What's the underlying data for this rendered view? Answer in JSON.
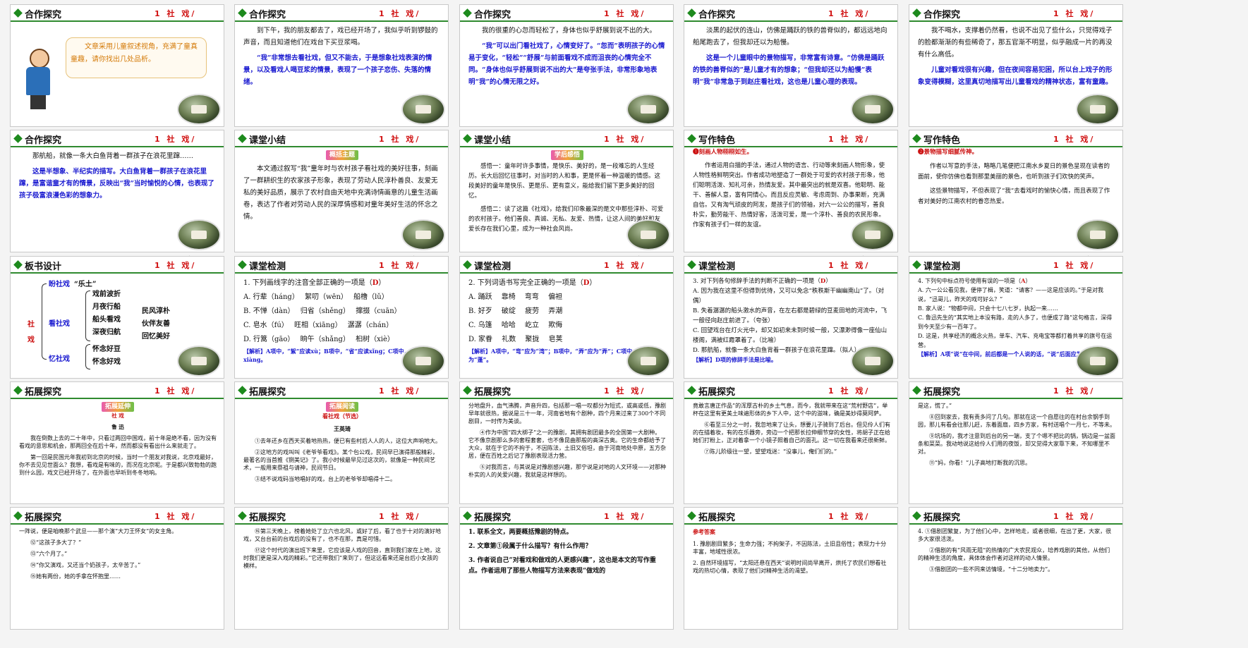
{
  "slides": [
    {
      "num": "41",
      "section": "合作探究",
      "title": "1 社 戏/",
      "bubble": "文章采用儿童叙述视角，充满了童真童趣，请你找出几处品析。"
    },
    {
      "num": "42",
      "section": "合作探究",
      "title": "1 社 戏/",
      "p1": "到下午，我的朋友都去了，戏已经开场了，我似乎听到锣鼓的声音，而且知道他们在戏台下买豆浆喝。",
      "p2": "“我”非常想去看社戏，但又不能去，于是想象社戏表演的情景，以及看戏人喝豆浆的情景，表现了一个孩子恋伤、失落的情绪。"
    },
    {
      "num": "43",
      "section": "合作探究",
      "title": "1 社 戏/",
      "p1": "我的很重的心忽而轻松了，身体也似乎舒展到说不出的大。",
      "p2": "“我”可以出门看社戏了，心情变好了。“忽而”表明孩子的心情易于变化，“轻松”“舒展”与前面看戏不成而沮丧的心情完全不同。“身体也似乎舒展到说不出的大”是夸张手法，非常形象地表明“我”的心情无限之好。"
    },
    {
      "num": "44",
      "section": "合作探究",
      "title": "1 社 戏/",
      "p1": "淡黑的起伏的连山，仿佛是踊跃的铁的兽脊似的，都远远地向船尾跑去了，但我却还以为船慢。",
      "p2": "这是一个儿童眼中的景物描写，非常富有诗意。“仿佛是踊跃的铁的兽脊似的”是儿童才有的想象；“但我却还以为船慢”表明“我”非常急于到赵庄看社戏，这也是儿童心理的表现。"
    },
    {
      "num": "45",
      "section": "合作探究",
      "title": "1 社 戏/",
      "p1": "我不喝水，支撑着仍然看，也说不出见了些什么，只觉得戏子的脸都渐渐的有些稀奇了，那五官渐不明显，似乎融成一片的再没有什么高低。",
      "p2": "儿童对看戏很有兴趣，但在夜间容易犯困，所以台上戏子的形象变得模糊，这里真切地描写出儿童看戏的精神状态，富有童趣。"
    },
    {
      "num": "46",
      "section": "合作探究",
      "title": "1 社 戏/",
      "p1": "那航船，就像一条大白鱼背着一群孩子在浪花里蹿……",
      "p2": "这是半想象、半纪实的描写。大白鱼背着一群孩子在浪花里蹿，是富谐童才有的情景，反映出“我”当时愉悦的心情，也表现了孩子极富浪漫色彩的想象力。"
    },
    {
      "num": "47",
      "section": "课堂小结",
      "title": "1 社 戏/",
      "badge": "概括主题",
      "p1": "本文通过叙写“我”童年时与农村孩子看社戏的美好往事，刻画了一群耕织生的农家孩子形象，表现了劳动人民淳朴善良、友爱无私的美好品质，展示了农村自由天地中充满诗情画意的儿童生活画卷，表达了作者对劳动人民的深厚情感和对童年美好生活的怀念之情。"
    },
    {
      "num": "48",
      "section": "课堂小结",
      "title": "1 社 戏/",
      "badge": "学后感悟",
      "p1": "感悟一：童年时许多事情，是快乐、美好的，是一段难忘的人生经历。长大后回忆往事时，对当时的人和事，更是怀着一种温暖的情感。这段美好的童年是快乐、更是乐、更有意义，能给我们留下更多美好的回忆。",
      "p2": "感悟二：读了这篇《社戏》，给我们印象最深的是文中那些淳朴、可爱的农村孩子。他们善良、真诚、无私、友爱、热情，让这人间的美好和友爱长存在我们心里，成为一种社会风尚。"
    },
    {
      "num": "49",
      "section": "写作特色",
      "title": "1 社 戏/",
      "h": "❶刻画人物栩栩如生。",
      "p1": "作者运用白描的手法，通过人物的语言、行动等来刻画人物形象，使人物性格鲜明突出。作者成功地塑造了一群处于可爱的农村孩子形象，他们聪明活泼、知礼可亲，热情友爱。其中最突出的就是双喜。他聪明、能干、善解人意，富有同情心。而且反应灵敏、考虑周到、办事果断，充满自信。又有淘气顽皮的阿发，是孩子们的领袖，对六一公公的描写，善良朴实，勤劳能干、热情好客，活泼可爱，是一个淳朴、善良的农民形象。作家有孩子们一样的友谊。"
    },
    {
      "num": "50",
      "section": "写作特色",
      "title": "1 社 戏/",
      "h": "❷景物描写细腻传神。",
      "p1": "作者以写意的手法，略略几笔便把江南水乡夏日的景色呈现在读者的面前，使你仿佛也看到那里美丽的景色，也听到孩子们欢快的笑声。",
      "p2": "这些景物描写，不但表现了“我”去看戏时的愉快心情，而且表现了作者对美好的江南农村的眷恋热爱。"
    },
    {
      "num": "51",
      "section": "板书设计",
      "title": "1 社 戏/",
      "root": "社 戏",
      "b1": "盼社戏",
      "b1r": "“乐土”",
      "b2": "看社戏",
      "b2a": "戏前波折",
      "b2b": "月夜行船",
      "b2c": "船头看戏",
      "b2d": "深夜归航",
      "b3": "忆社戏",
      "b3a": "怀念好豆",
      "b3b": "怀念好戏",
      "r1": "民风淳朴",
      "r2": "伙伴友善",
      "r3": "回忆美好"
    },
    {
      "num": "52",
      "section": "课堂检测",
      "title": "1 社 戏/",
      "q": "1. 下列画线字的注音全部正确的一项是（",
      "ans": "D",
      "qe": "）",
      "oA": "A. 行辈（háng）　 絮叨（wēn）　 船橹（lǔ）",
      "oB": "B. 不惮（dàn）　 归省（shěng）　 撺掇（cuān）",
      "oC": "C. 皂水（fú）　 旺相（xiāng）　 潺潺（chán）",
      "oD": "D. 行篙（gāo）　 晌午（shǎng）　 桕树（xiè）",
      "hint": "【解析】A项中，“絮”应读xù；B项中，“省”应读xǐng；C项中，“相”应读xiàng。"
    },
    {
      "num": "53",
      "section": "课堂检测",
      "title": "1 社 戏/",
      "q": "2. 下列词语书写完全正确的一项是（",
      "ans": "D",
      "qe": "）",
      "oA": "A. 踊跃　 靠椅　 弯弯　 偏袒",
      "oB": "B. 好歹　 破绽　 疲劳　 弄潮",
      "oC": "C. 乌篷　 哈哈　 屹立　 欺侮",
      "oD": "D. 家眷　 礼数　 聚拢　 皂荚",
      "hint": "【解析】A项中，“弯”应为“湾”；B项中，“弄”应为“弄”；C项中，“篷”应为“蓬”。"
    },
    {
      "num": "54",
      "section": "课堂检测",
      "title": "1 社 戏/",
      "q": "3. 对下列各句修辞手法的判断不正确的一项是（",
      "ans": "D",
      "qe": "）",
      "oA": "A. 因为我在这里不但得到优待，又可以免念“秩秩斯干幽幽南山”了。（对偶）",
      "oB": "B. 失着潺潺的船头激水的声音，在左右都是碧绿的豆麦田地的河流中，飞一般径向赵庄前进了。（夸张）",
      "oC": "C. 回望戏台在灯火光中，却又如初来未到时候一般，又漂渺得像一座仙山楼阁，满被红霞罩着了。（比喻）",
      "oD": "D. 那航船，就像一条大白鱼背着一群孩子在浪花里蹿。（拟人）",
      "hint": "【解析】D项的修辞手法是比喻。"
    },
    {
      "num": "55",
      "section": "课堂检测",
      "title": "1 社 戏/",
      "q": "4. 下列句中标点符号使用有误的一项是（",
      "ans": "A",
      "qe": "）",
      "oA": "A. 六一公公看见我，便停了楫，笑道：“请客？——这是应该的。”于是对我说，“迅哥儿，昨天的戏可好么？”",
      "oB": "B. 家人说：“物都中间，只会十七八七岁，执起一来……",
      "oC": "C. 鲁迅先生的“其实地上本没有路，走的人多了，也便成了路”这句格言，深得到今天至少有一百年了。",
      "oD": "D. 这是，共享经济的概念火热，单车、汽车、充电宝等都打着共享的旗号在运营。",
      "hint": "【解析】A项“说”在中间，前后都是一个人说的话，“说”后面应为逗号。"
    },
    {
      "num": "56",
      "section": "拓展探究",
      "title": "1 社 戏/",
      "badge": "拓展延伸",
      "sub": "社 戏",
      "author": "鲁 迅",
      "p1": "我在倒数上去的二十年中，只看过两回中国戏，前十年是绝不看，因为没有看戏的意思和机会，那两回全在后十年，然而都没有看出什么来就走了。",
      "p2": "第一回是民国元年我初到北京的时候，当时一个朋友对我说，北京戏最好，你不去见见世面么？我想，看戏是有味的，而况在北京呢。于是都兴致勃勃的跑到什么园，戏文已经开场了，在外面也早听到冬冬地响。"
    },
    {
      "num": "57",
      "section": "拓展探究",
      "title": "1 社 戏/",
      "badge": "拓展阅读",
      "sub": "看社戏（节选）",
      "author": "王英琦",
      "p1": "①去年还乡在西天买着地热热，便已有些村后人人的人，这位大声响地大。",
      "p2": "②这地方的戏叫叫《老爷爷看戏》。某个包公戏，民间早已演得那般精彩，最著名的当首推《铡美记》了。我小时候最早见过这次的，就像是一种民间艺术，一般用来祭祖与请神，民间节日。",
      "p3": "③结不说戏码当地唱好的戏，台上的老爷爷却唱得十二。"
    },
    {
      "num": "58",
      "section": "拓展探究",
      "title": "1 社 戏/",
      "p1": "分地盘升，血气沸腾，声音升四，包括那一唱一叹都分为短式，或高或低，豫剧早年就很热，据说是三十一年，河南省地有个剧种，四个月来过来了300个不同剧目，一时传为美谈。",
      "p2": "④作为中国“四大梆子”之一的豫剧，其拥有剧团最多的全国第一大剧种。它不像京剧那么多的套程套套，也不像昆曲那般的高深古奥。它的生命都给予了大众，就在于它的不拘于，不因陈法，土旧又俗坦，由于河南地处中原，五方杂居，便在百姓之后记了豫剧表现活力营。",
      "p3": "⑤对我而言，与其说是对豫剧感兴趣，那宁说是对地的人文环境——对那种朴实的人的关爱兴趣，我就是这样想的。"
    },
    {
      "num": "59",
      "section": "拓展探究",
      "title": "1 社 戏/",
      "p1": "竟敢言唐正作品”的浑厚古朴的乡土气息，而今，我就带来在这“荒村野店”，举杯在这里有更美土味遍形体的乡下人中，这个中的滋味，确是美妙得莫阿萨。",
      "p2": "⑥看至三分之一时，我忽地来了让头，想要儿子骑到了后台。但见伶人们有的在描着妆，有的在乐器旁，旁边一个把那长拉伸细节穿的女性，将胡子正在给她们打粉上，正对着拿一个小镜子照着自己的面孔。这一切在我看来还很新鲜。",
      "p3": "⑦陈儿阶级往一望，望望戏迷：“没事儿，俺们们的。”"
    },
    {
      "num": "60",
      "section": "拓展探究",
      "title": "1 社 戏/",
      "p1": "是这，慌了。”",
      "p2": "⑧回到家去，我有责多问了几句。那就在这一个自愿往的在村台余钢手到园，那儿有看会往那儿赶，东着面扇，四乡方家，有村送唱个一月七，不等未。",
      "p3": "⑨坑场的，我才注意到后台的另一端，支了个嗯不把比的锅，锅边是一盆面条和菜菜。我动地说这给伶人们用的夜饭，却又觉得大家靠下来，不知哪里不对。",
      "p4": "⑪“妈，你看！”儿子高地打断我的沉思。"
    },
    {
      "num": "",
      "section": "拓展探究",
      "title": "1 社 戏/",
      "p1": "一阵说，便是咱晚那个武旦——那个演“大刀王怀女”的女主角。",
      "p2": "⑫“这孩子多大了？”",
      "p3": "⑬“六个月了。”",
      "p4": "⑭“你又演戏，又还当个奶孩子，太辛苦了。”",
      "p5": "⑮她有两份，她的手拿在怀抱里……"
    },
    {
      "num": "",
      "section": "拓展探究",
      "title": "1 社 戏/",
      "p1": "⑯第三天晚上，榜着她处了立六也北风，或好了后，看了也于十对的演好地戏，又台台前的台戏后的没有了，也不在那，真是可惜。",
      "p2": "⑰这个时代的演出班下来里，它应该是人戏的回音，直到我们家在上地，这时我们更是深入戏的精彩。”它还带我们”来到了，但这远看来还是台后小女孩的模样。"
    },
    {
      "num": "",
      "section": "拓展探究",
      "title": "1 社 戏/",
      "q1": "1. 联系全文，两要概括豫剧的特点。",
      "q2": "2. 文章第①段属于什么描写？有什么作用？",
      "q3": "3. 作者说自己“对看戏和做戏的人更感兴趣”，这也是本文的写作重点。作者运用了那些人物描写方法来表现“做戏的"
    },
    {
      "num": "",
      "section": "拓展探究",
      "title": "1 社 戏/",
      "h": "参考答案",
      "p1": "1. 豫剧剧目繁多；生命力强；不拘架子，不因陈法，土旧且俗性；表现力十分丰富，地域性很浓。",
      "p2": "2. 自然环境描写，“太阳还悬在西天”说明时间尚早离开，烘托了农民们想看社戏的热切心情，表现了他们对精神生活的渴望。"
    },
    {
      "num": "",
      "section": "拓展探究",
      "title": "1 社 戏/",
      "p1": "4. ①借剧团繁复，为了他们心中，怎样地走，或者很细，在出了更，大家，很多大家很活泼。",
      "p2": "②借剧的有“风雨无阻”的热情的广大农民观众，培养戏剧的其他，从他们的精神生活的角度，具体体会作者对这样的动人情景。",
      "p3": "③借剧团的一些不同来访情境，“十二分地卖力”。"
    }
  ]
}
